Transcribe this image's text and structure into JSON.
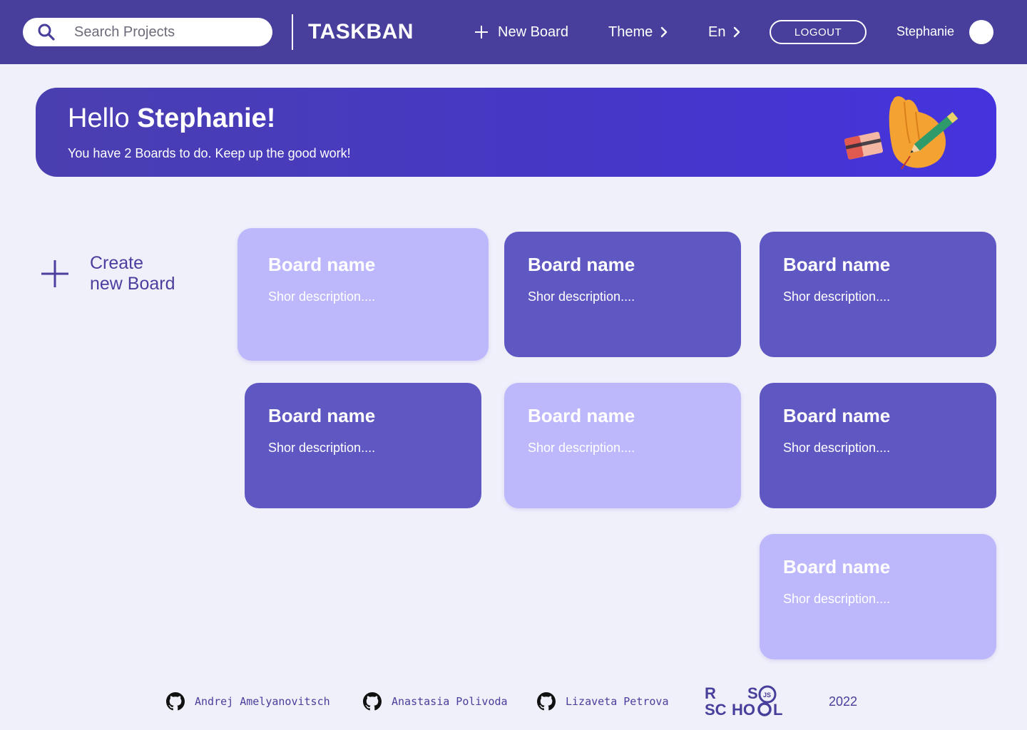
{
  "header": {
    "search_placeholder": "Search Projects",
    "logo": "TASKBAN",
    "new_board": "New Board",
    "theme": "Theme",
    "language": "En",
    "logout": "LOGOUT",
    "username": "Stephanie"
  },
  "banner": {
    "greeting": "Hello",
    "name": "Stephanie!",
    "subtitle": "You have 2 Boards to do. Keep up the good work!"
  },
  "create_board": {
    "line1": "Create",
    "line2": "new Board"
  },
  "boards": [
    {
      "title": "Board name",
      "description": "Shor description....",
      "variant": "light"
    },
    {
      "title": "Board name",
      "description": "Shor description....",
      "variant": "dark"
    },
    {
      "title": "Board name",
      "description": "Shor description....",
      "variant": "dark"
    },
    {
      "title": "Board name",
      "description": "Shor description....",
      "variant": "dark"
    },
    {
      "title": "Board name",
      "description": "Shor description....",
      "variant": "light"
    },
    {
      "title": "Board name",
      "description": "Shor description....",
      "variant": "dark"
    },
    {
      "title": "Board name",
      "description": "Shor description....",
      "variant": "light"
    }
  ],
  "footer": {
    "authors": [
      "Andrej Amelyanovitsch",
      "Anastasia Polivoda",
      "Lizaveta Petrova"
    ],
    "school_logo": "RS SCHOOL JS",
    "year": "2022"
  },
  "colors": {
    "header_bg": "#473f9b",
    "page_bg": "#f0f0fb",
    "card_dark": "#5f58c3",
    "card_light": "#bdb8fc",
    "accent_text": "#4a3f9e"
  },
  "icons": {
    "search": "search-icon",
    "plus": "plus-icon",
    "chevron": "chevron-right-icon",
    "github": "github-icon"
  }
}
